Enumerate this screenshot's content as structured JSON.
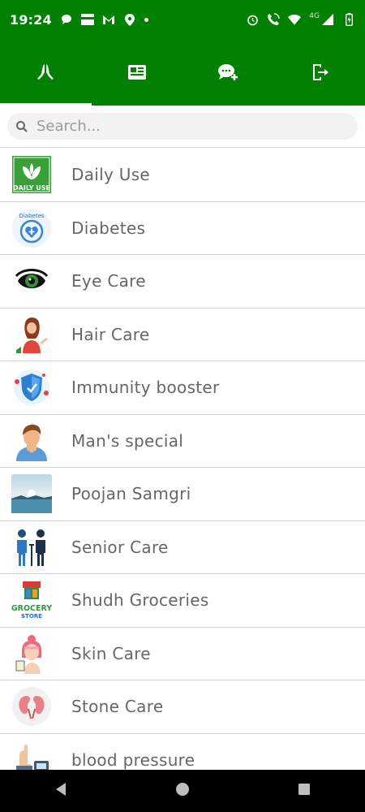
{
  "status": {
    "time": "19:24",
    "network": "4G"
  },
  "tabs": [
    {
      "name": "prayer-icon",
      "active": true
    },
    {
      "name": "news-icon",
      "active": false
    },
    {
      "name": "chat-add-icon",
      "active": false
    },
    {
      "name": "logout-icon",
      "active": false
    }
  ],
  "search": {
    "placeholder": "Search..."
  },
  "categories": [
    {
      "label": "Daily Use",
      "icon": "daily-use-icon",
      "thumb_text": "DAILY USE"
    },
    {
      "label": "Diabetes",
      "icon": "diabetes-icon",
      "thumb_text": "Diabetes"
    },
    {
      "label": "Eye Care",
      "icon": "eye-icon"
    },
    {
      "label": "Hair Care",
      "icon": "hair-care-icon"
    },
    {
      "label": "Immunity booster",
      "icon": "shield-virus-icon"
    },
    {
      "label": "Man's special",
      "icon": "man-avatar-icon"
    },
    {
      "label": "Poojan Samgri",
      "icon": "landscape-photo-icon"
    },
    {
      "label": "Senior Care",
      "icon": "senior-couple-icon"
    },
    {
      "label": "Shudh Groceries",
      "icon": "grocery-store-icon",
      "thumb_text": "GROCERY",
      "thumb_text2": "STORE"
    },
    {
      "label": "Skin Care",
      "icon": "skin-care-icon"
    },
    {
      "label": "Stone Care",
      "icon": "kidney-icon"
    },
    {
      "label": "blood pressure",
      "icon": "bp-monitor-icon"
    }
  ],
  "colors": {
    "appbar": "#028002",
    "text": "#666666"
  }
}
